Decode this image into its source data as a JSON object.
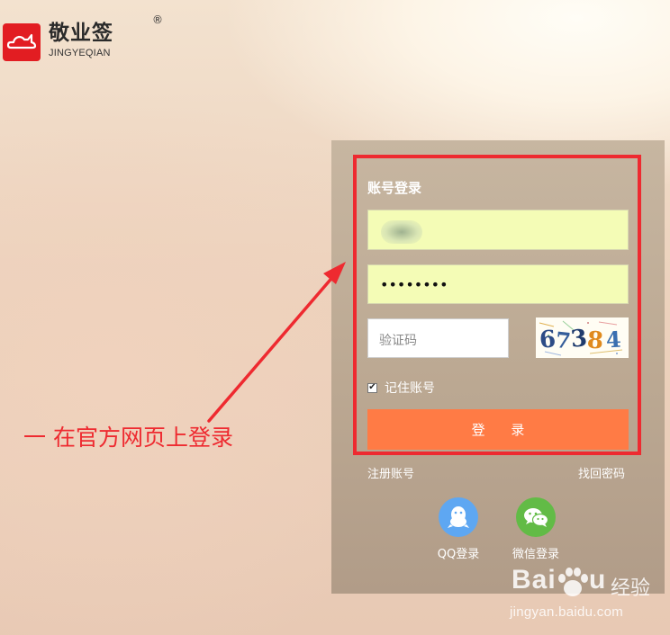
{
  "brand": {
    "name_cn": "敬业签",
    "name_en": "JINGYEQIAN",
    "registered_mark": "®",
    "color": "#e21d22"
  },
  "login_form": {
    "title": "账号登录",
    "username_value": "",
    "password_mask": "••••••••",
    "captcha_placeholder": "验证码",
    "captcha_code": "67384",
    "remember_checked": true,
    "remember_label": "记住账号",
    "login_button": "登 录",
    "login_button_color": "#ff7b45",
    "register_link": "注册账号",
    "forgot_link": "找回密码",
    "social": [
      {
        "label": "QQ登录",
        "icon": "qq-icon",
        "color": "#5ea7f2"
      },
      {
        "label": "微信登录",
        "icon": "wechat-icon",
        "color": "#62bb46"
      }
    ]
  },
  "annotation": {
    "text": "一 在官方网页上登录",
    "color": "#ee2a30"
  },
  "watermark": {
    "brand": "Bai",
    "brand_suffix": "u",
    "text_cn": "经验",
    "url": "jingyan.baidu.com"
  }
}
